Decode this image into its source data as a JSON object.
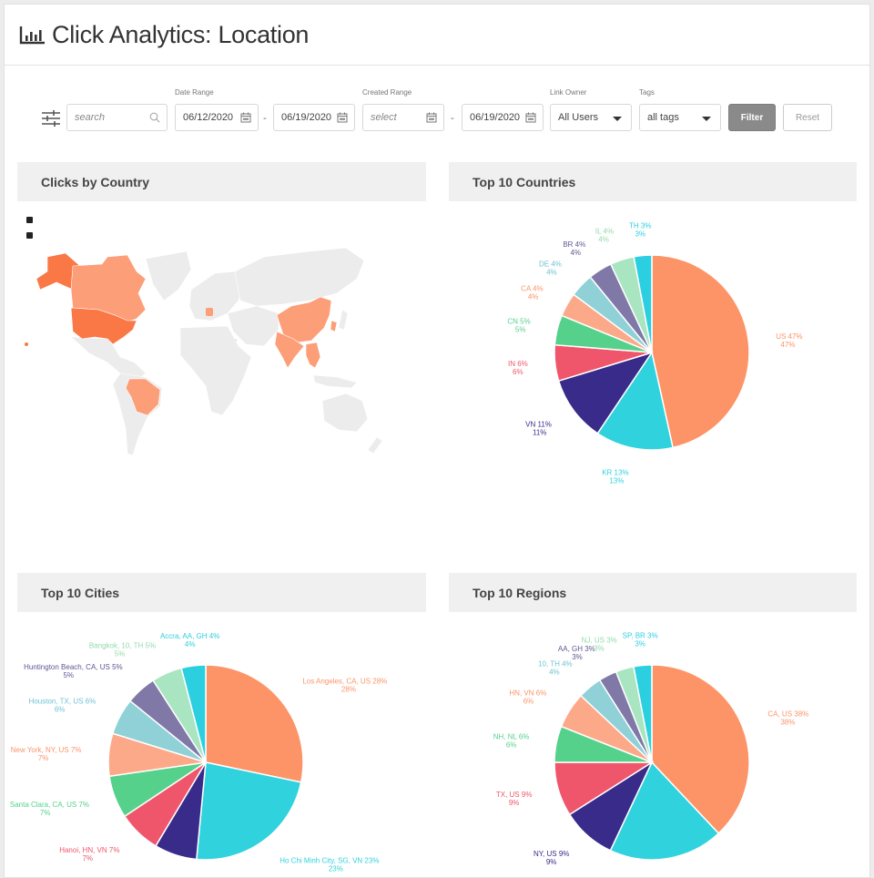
{
  "header": {
    "title": "Click Analytics: Location",
    "icon": "bar-chart-icon"
  },
  "filters": {
    "search": {
      "placeholder": "search",
      "value": ""
    },
    "date_range": {
      "label": "Date Range",
      "from": "06/12/2020",
      "to": "06/19/2020",
      "separator": "-"
    },
    "created_range": {
      "label": "Created Range",
      "from_placeholder": "select",
      "to": "06/19/2020",
      "separator": "-"
    },
    "link_owner": {
      "label": "Link Owner",
      "selected": "All Users"
    },
    "tags": {
      "label": "Tags",
      "selected": "all tags"
    },
    "filter_button": "Filter",
    "reset_button": "Reset"
  },
  "colors": {
    "palette": [
      "#fc9468",
      "#30d2de",
      "#382b8a",
      "#ef566b",
      "#56d18c",
      "#fca98a",
      "#8fd1d6",
      "#8079a8",
      "#a8e5c0",
      "#2bcfe0"
    ],
    "map_highlight_strong": "#fa7846",
    "map_highlight_light": "#fc9e78",
    "map_base": "#ececec",
    "header_bg": "#f0f0f0"
  },
  "cards": {
    "map": {
      "title": "Clicks by Country"
    },
    "countries": {
      "title": "Top 10 Countries"
    },
    "cities": {
      "title": "Top 10 Cities"
    },
    "regions": {
      "title": "Top 10 Regions"
    }
  },
  "chart_data": [
    {
      "type": "map",
      "title": "Clicks by Country",
      "highlighted_countries": [
        "US",
        "CA",
        "BR",
        "CN",
        "IN",
        "VN",
        "TH",
        "KR",
        "DE",
        "IL"
      ],
      "strongest": "US"
    },
    {
      "type": "pie",
      "title": "Top 10 Countries",
      "slices": [
        {
          "label": "US",
          "value": 47
        },
        {
          "label": "KR",
          "value": 13
        },
        {
          "label": "VN",
          "value": 11
        },
        {
          "label": "IN",
          "value": 6
        },
        {
          "label": "CN",
          "value": 5
        },
        {
          "label": "CA",
          "value": 4
        },
        {
          "label": "DE",
          "value": 4
        },
        {
          "label": "BR",
          "value": 4
        },
        {
          "label": "IL",
          "value": 4
        },
        {
          "label": "TH",
          "value": 3
        }
      ]
    },
    {
      "type": "pie",
      "title": "Top 10 Cities",
      "slices": [
        {
          "label": "Los Angeles, CA, US",
          "value": 28
        },
        {
          "label": "Ho Chi Minh City, SG, VN",
          "value": 23
        },
        {
          "label": "",
          "value": 7
        },
        {
          "label": "Hanoi, HN, VN",
          "value": 7
        },
        {
          "label": "Santa Clara, CA, US",
          "value": 7
        },
        {
          "label": "New York, NY, US",
          "value": 7
        },
        {
          "label": "Houston, TX, US",
          "value": 6
        },
        {
          "label": "Huntington Beach, CA, US",
          "value": 5
        },
        {
          "label": "Bangkok, 10, TH",
          "value": 5
        },
        {
          "label": "Accra, AA, GH",
          "value": 4
        }
      ]
    },
    {
      "type": "pie",
      "title": "Top 10 Regions",
      "slices": [
        {
          "label": "CA, US",
          "value": 38
        },
        {
          "label": "",
          "value": 19
        },
        {
          "label": "NY, US",
          "value": 9
        },
        {
          "label": "TX, US",
          "value": 9
        },
        {
          "label": "NH, NL",
          "value": 6
        },
        {
          "label": "HN, VN",
          "value": 6
        },
        {
          "label": "10, TH",
          "value": 4
        },
        {
          "label": "AA, GH",
          "value": 3
        },
        {
          "label": "NJ, US",
          "value": 3
        },
        {
          "label": "SP, BR",
          "value": 3
        }
      ]
    }
  ]
}
